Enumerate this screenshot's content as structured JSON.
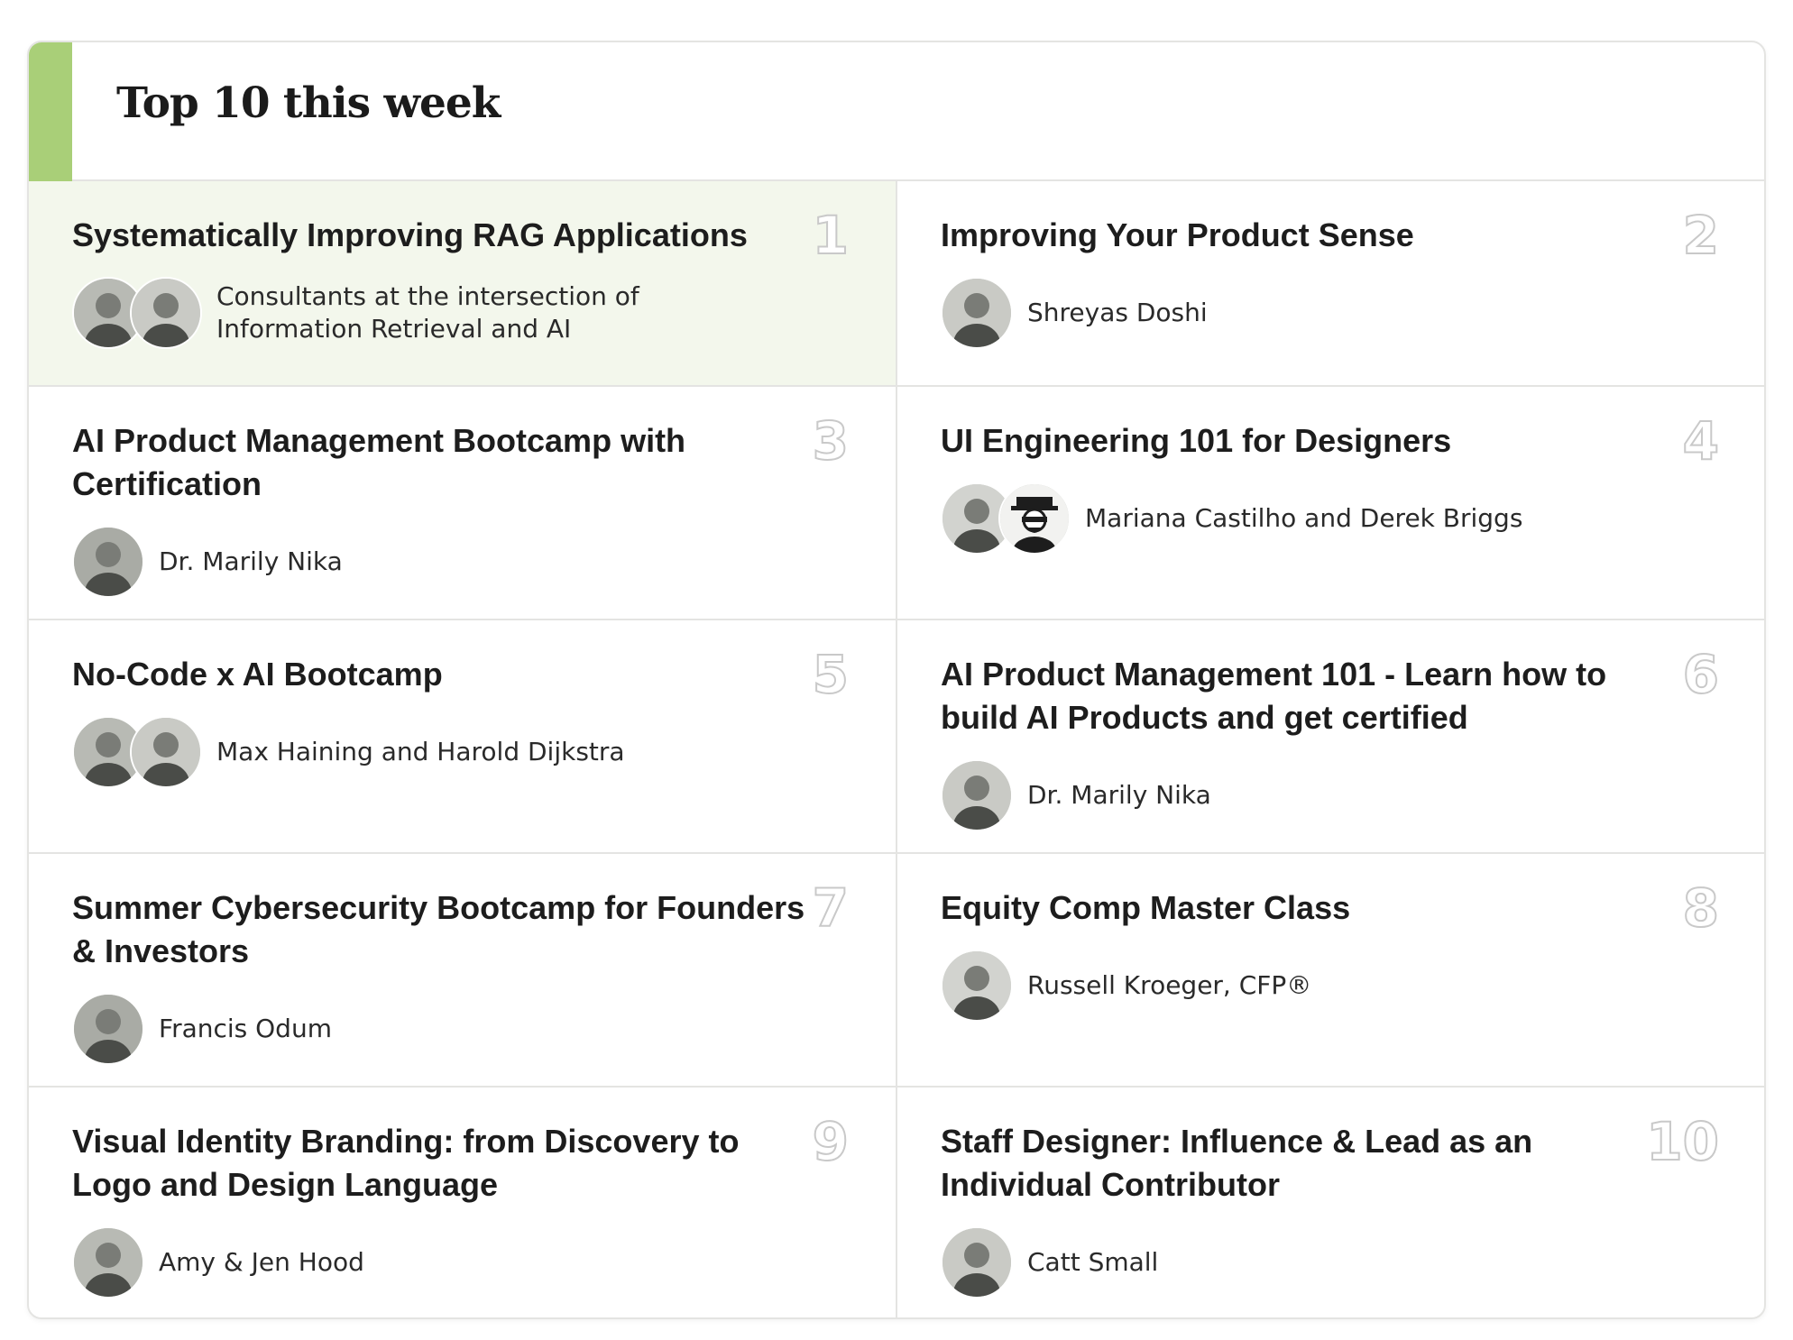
{
  "header": {
    "title": "Top 10 this week",
    "accent_color": "#a9cf78"
  },
  "colors": {
    "highlight_background": "#f3f7ec",
    "border": "#e4e4e2",
    "rank_outline": "#c9c9c9"
  },
  "courses": [
    {
      "rank": "1",
      "title": "Systematically Improving RAG Applications",
      "instructor": "Consultants at the intersection of Information Retrieval and AI",
      "avatars": [
        "avatar-person-icon",
        "avatar-person-icon"
      ],
      "highlighted": true
    },
    {
      "rank": "2",
      "title": "Improving Your Product Sense",
      "instructor": "Shreyas Doshi",
      "avatars": [
        "avatar-person-icon"
      ],
      "highlighted": false
    },
    {
      "rank": "3",
      "title": "AI Product Management Bootcamp with Certification",
      "instructor": "Dr. Marily Nika",
      "avatars": [
        "avatar-person-icon"
      ],
      "highlighted": false
    },
    {
      "rank": "4",
      "title": "UI Engineering 101 for Designers",
      "instructor": "Mariana Castilho and Derek Briggs",
      "avatars": [
        "avatar-person-icon",
        "avatar-illustration-icon"
      ],
      "highlighted": false
    },
    {
      "rank": "5",
      "title": "No-Code x AI Bootcamp",
      "instructor": "Max Haining and Harold Dijkstra",
      "avatars": [
        "avatar-person-icon",
        "avatar-person-icon"
      ],
      "highlighted": false
    },
    {
      "rank": "6",
      "title": "AI Product Management 101 - Learn how to build AI Products and get certified",
      "instructor": "Dr. Marily Nika",
      "avatars": [
        "avatar-person-icon"
      ],
      "highlighted": false
    },
    {
      "rank": "7",
      "title": "Summer Cybersecurity Bootcamp for Founders & Investors",
      "instructor": "Francis Odum",
      "avatars": [
        "avatar-person-icon"
      ],
      "highlighted": false
    },
    {
      "rank": "8",
      "title": "Equity Comp Master Class",
      "instructor": "Russell Kroeger, CFP®",
      "avatars": [
        "avatar-person-icon"
      ],
      "highlighted": false
    },
    {
      "rank": "9",
      "title": "Visual Identity Branding: from Discovery to Logo and Design Language",
      "instructor": "Amy & Jen Hood",
      "avatars": [
        "avatar-person-icon"
      ],
      "highlighted": false
    },
    {
      "rank": "10",
      "title": "Staff Designer: Influence & Lead as an Individual Contributor",
      "instructor": "Catt Small",
      "avatars": [
        "avatar-person-icon"
      ],
      "highlighted": false
    }
  ]
}
